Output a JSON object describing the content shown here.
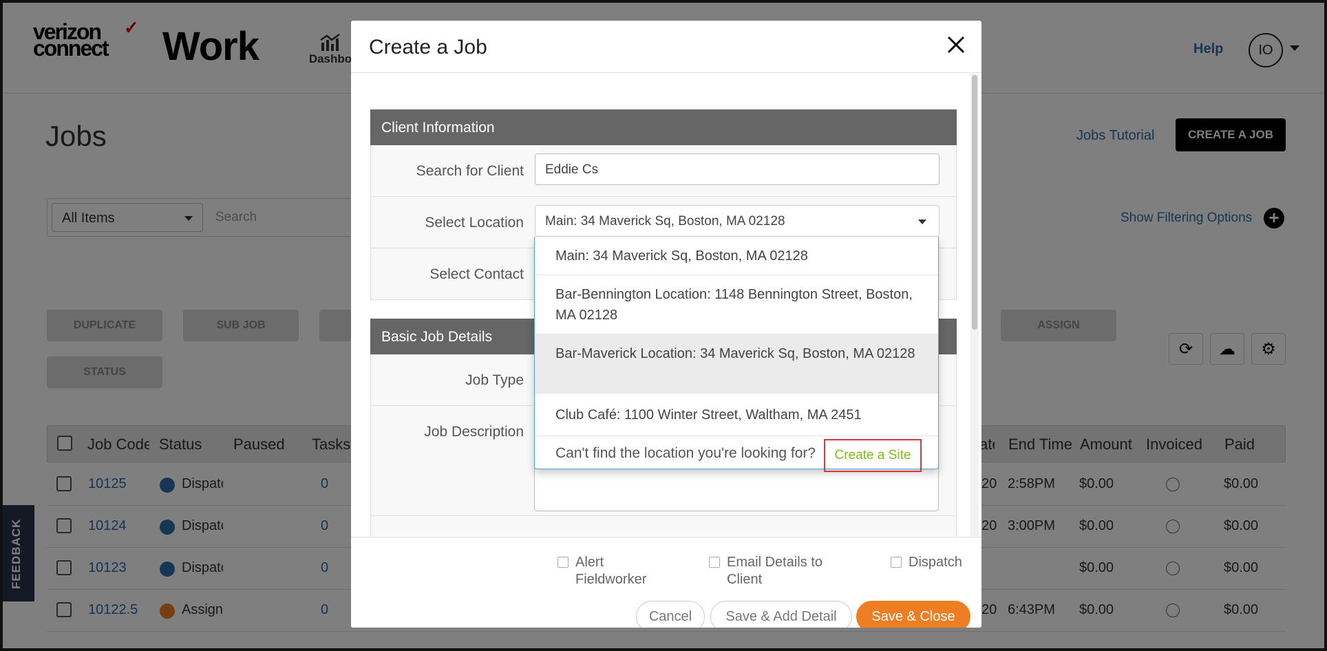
{
  "app": {
    "logo_line1": "verizon",
    "logo_line2": "connect",
    "product": "Work",
    "nav_dashboard": "Dashbo",
    "help": "Help",
    "avatar_initials": "IO"
  },
  "page": {
    "title": "Jobs",
    "tutorial_link": "Jobs Tutorial",
    "create_button": "CREATE A JOB",
    "filter_select": "All Items",
    "search_placeholder": "Search",
    "show_filtering": "Show Filtering Options",
    "actions": [
      "DUPLICATE",
      "SUB JOB",
      "ASSIGN",
      "STATUS"
    ]
  },
  "table": {
    "headers": {
      "job_code": "Job Code",
      "status": "Status",
      "paused": "Paused",
      "tasks": "Tasks",
      "start_frag": "ate",
      "end_time": "End Time",
      "amount": "Amount",
      "invoiced": "Invoiced",
      "paid": "Paid"
    },
    "rows": [
      {
        "code": "10125",
        "status": "Dispatched",
        "tasks": "0",
        "date_frag": "20",
        "end": "2:58PM",
        "amount": "$0.00",
        "paid": "$0.00"
      },
      {
        "code": "10124",
        "status": "Dispatched",
        "tasks": "0",
        "date_frag": "20",
        "end": "3:00PM",
        "amount": "$0.00",
        "paid": "$0.00"
      },
      {
        "code": "10123",
        "status": "Dispatched",
        "tasks": "0",
        "date_frag": "",
        "end": "",
        "amount": "$0.00",
        "paid": "$0.00"
      },
      {
        "code": "10122.5",
        "status": "Assigned",
        "tasks": "0",
        "date_frag": "20",
        "end": "6:43PM",
        "amount": "$0.00",
        "paid": "$0.00"
      }
    ]
  },
  "feedback_tab": "FEEDBACK",
  "modal": {
    "title": "Create a Job",
    "client_section": "Client Information",
    "search_client_label": "Search for Client",
    "search_client_value": "Eddie Cs",
    "select_location_label": "Select Location",
    "select_location_value": "Main: 34 Maverick Sq, Boston, MA 02128",
    "select_contact_label": "Select Contact",
    "job_section": "Basic Job Details",
    "job_type_label": "Job Type",
    "job_description_label": "Job Description",
    "location_options": [
      "Main: 34 Maverick Sq, Boston, MA 02128",
      "Bar-Bennington Location: 1148 Bennington Street, Boston, MA 02128",
      "Bar-Maverick Location: 34 Maverick Sq, Boston, MA 02128",
      "Club Café: 1100 Winter Street, Waltham, MA 2451"
    ],
    "not_found_text": "Can't find the location you're looking for?",
    "create_site_link": "Create a Site",
    "alert_fieldworker": "Alert Fieldworker",
    "email_details": "Email Details to Client",
    "dispatch": "Dispatch",
    "cancel": "Cancel",
    "save_add_detail": "Save & Add Detail",
    "save_close": "Save & Close"
  },
  "colors": {
    "brand_red": "#cd040b",
    "link_blue": "#2f6aa8",
    "section_gray": "#666666",
    "primary_orange": "#ef7d22",
    "create_site_green": "#7cbd1e",
    "highlight_box_red": "#d9363e"
  }
}
